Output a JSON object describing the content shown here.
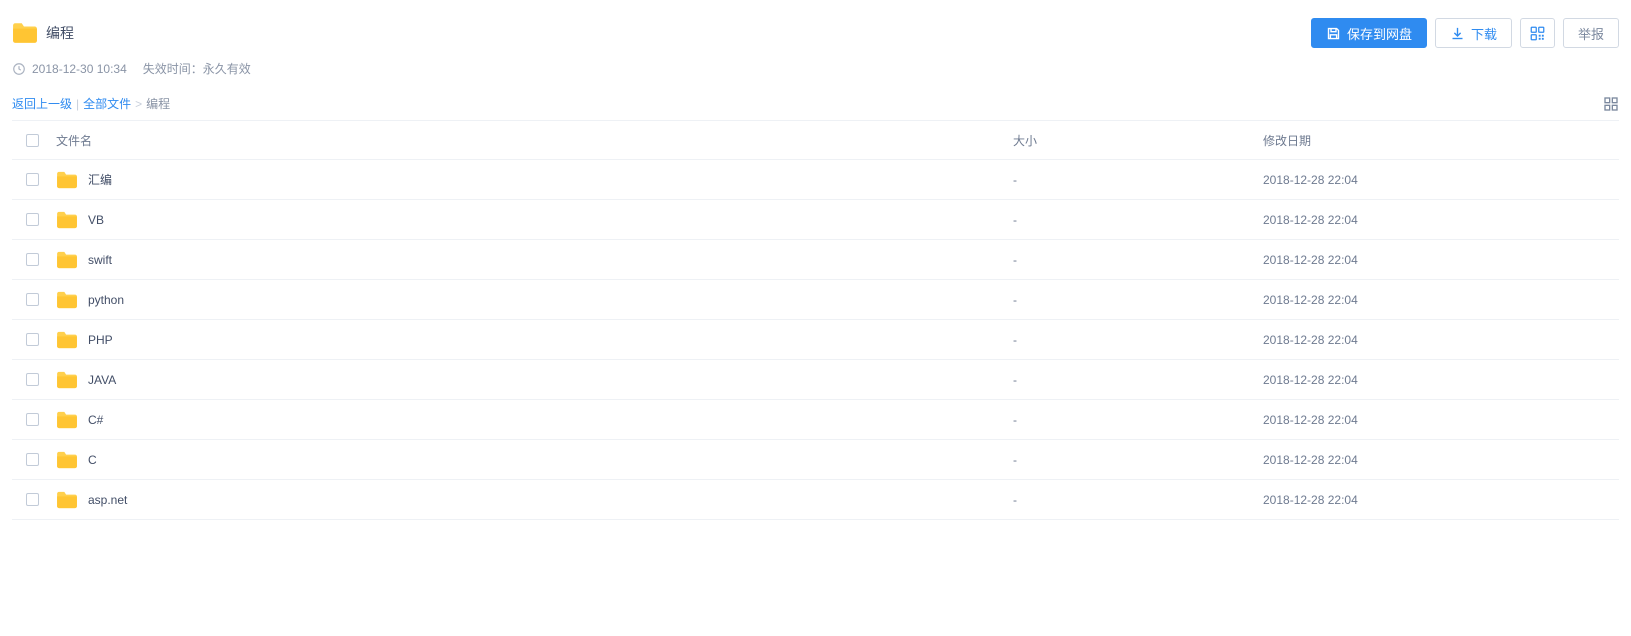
{
  "header": {
    "title": "编程"
  },
  "actions": {
    "save": "保存到网盘",
    "download": "下载",
    "report": "举报"
  },
  "meta": {
    "timestamp": "2018-12-30 10:34",
    "expire": "失效时间：永久有效"
  },
  "breadcrumb": {
    "back": "返回上一级",
    "all": "全部文件",
    "current": "编程"
  },
  "table": {
    "headers": {
      "name": "文件名",
      "size": "大小",
      "date": "修改日期"
    },
    "rows": [
      {
        "name": "汇编",
        "size": "-",
        "date": "2018-12-28 22:04"
      },
      {
        "name": "VB",
        "size": "-",
        "date": "2018-12-28 22:04"
      },
      {
        "name": "swift",
        "size": "-",
        "date": "2018-12-28 22:04"
      },
      {
        "name": "python",
        "size": "-",
        "date": "2018-12-28 22:04"
      },
      {
        "name": "PHP",
        "size": "-",
        "date": "2018-12-28 22:04"
      },
      {
        "name": "JAVA",
        "size": "-",
        "date": "2018-12-28 22:04"
      },
      {
        "name": "C#",
        "size": "-",
        "date": "2018-12-28 22:04"
      },
      {
        "name": "C",
        "size": "-",
        "date": "2018-12-28 22:04"
      },
      {
        "name": "asp.net",
        "size": "-",
        "date": "2018-12-28 22:04"
      }
    ]
  }
}
